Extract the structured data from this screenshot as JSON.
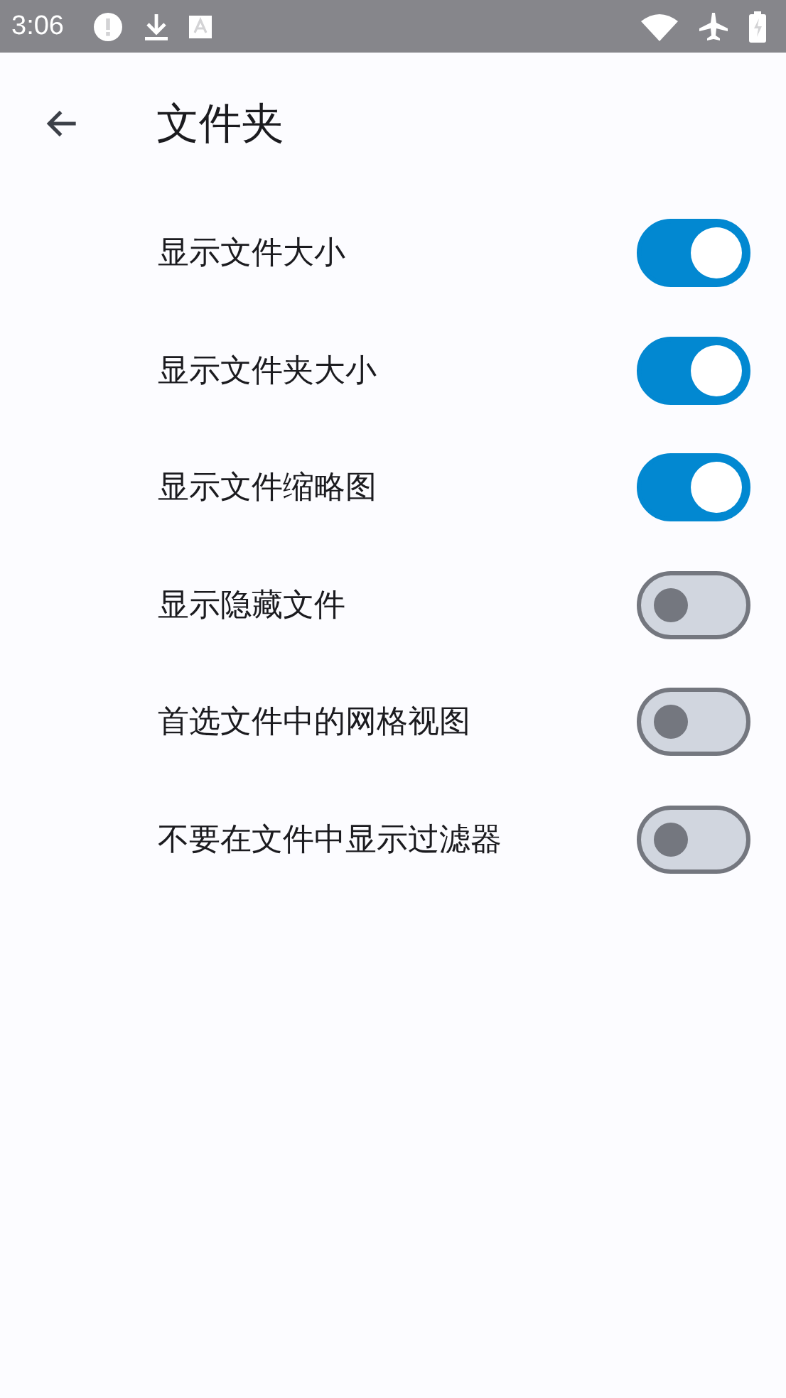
{
  "status_bar": {
    "time": "3:06"
  },
  "app_bar": {
    "title": "文件夹"
  },
  "settings": [
    {
      "label": "显示文件大小",
      "on": true
    },
    {
      "label": "显示文件夹大小",
      "on": true
    },
    {
      "label": "显示文件缩略图",
      "on": true
    },
    {
      "label": "显示隐藏文件",
      "on": false
    },
    {
      "label": "首选文件中的网格视图",
      "on": false
    },
    {
      "label": "不要在文件中显示过滤器",
      "on": false
    }
  ]
}
